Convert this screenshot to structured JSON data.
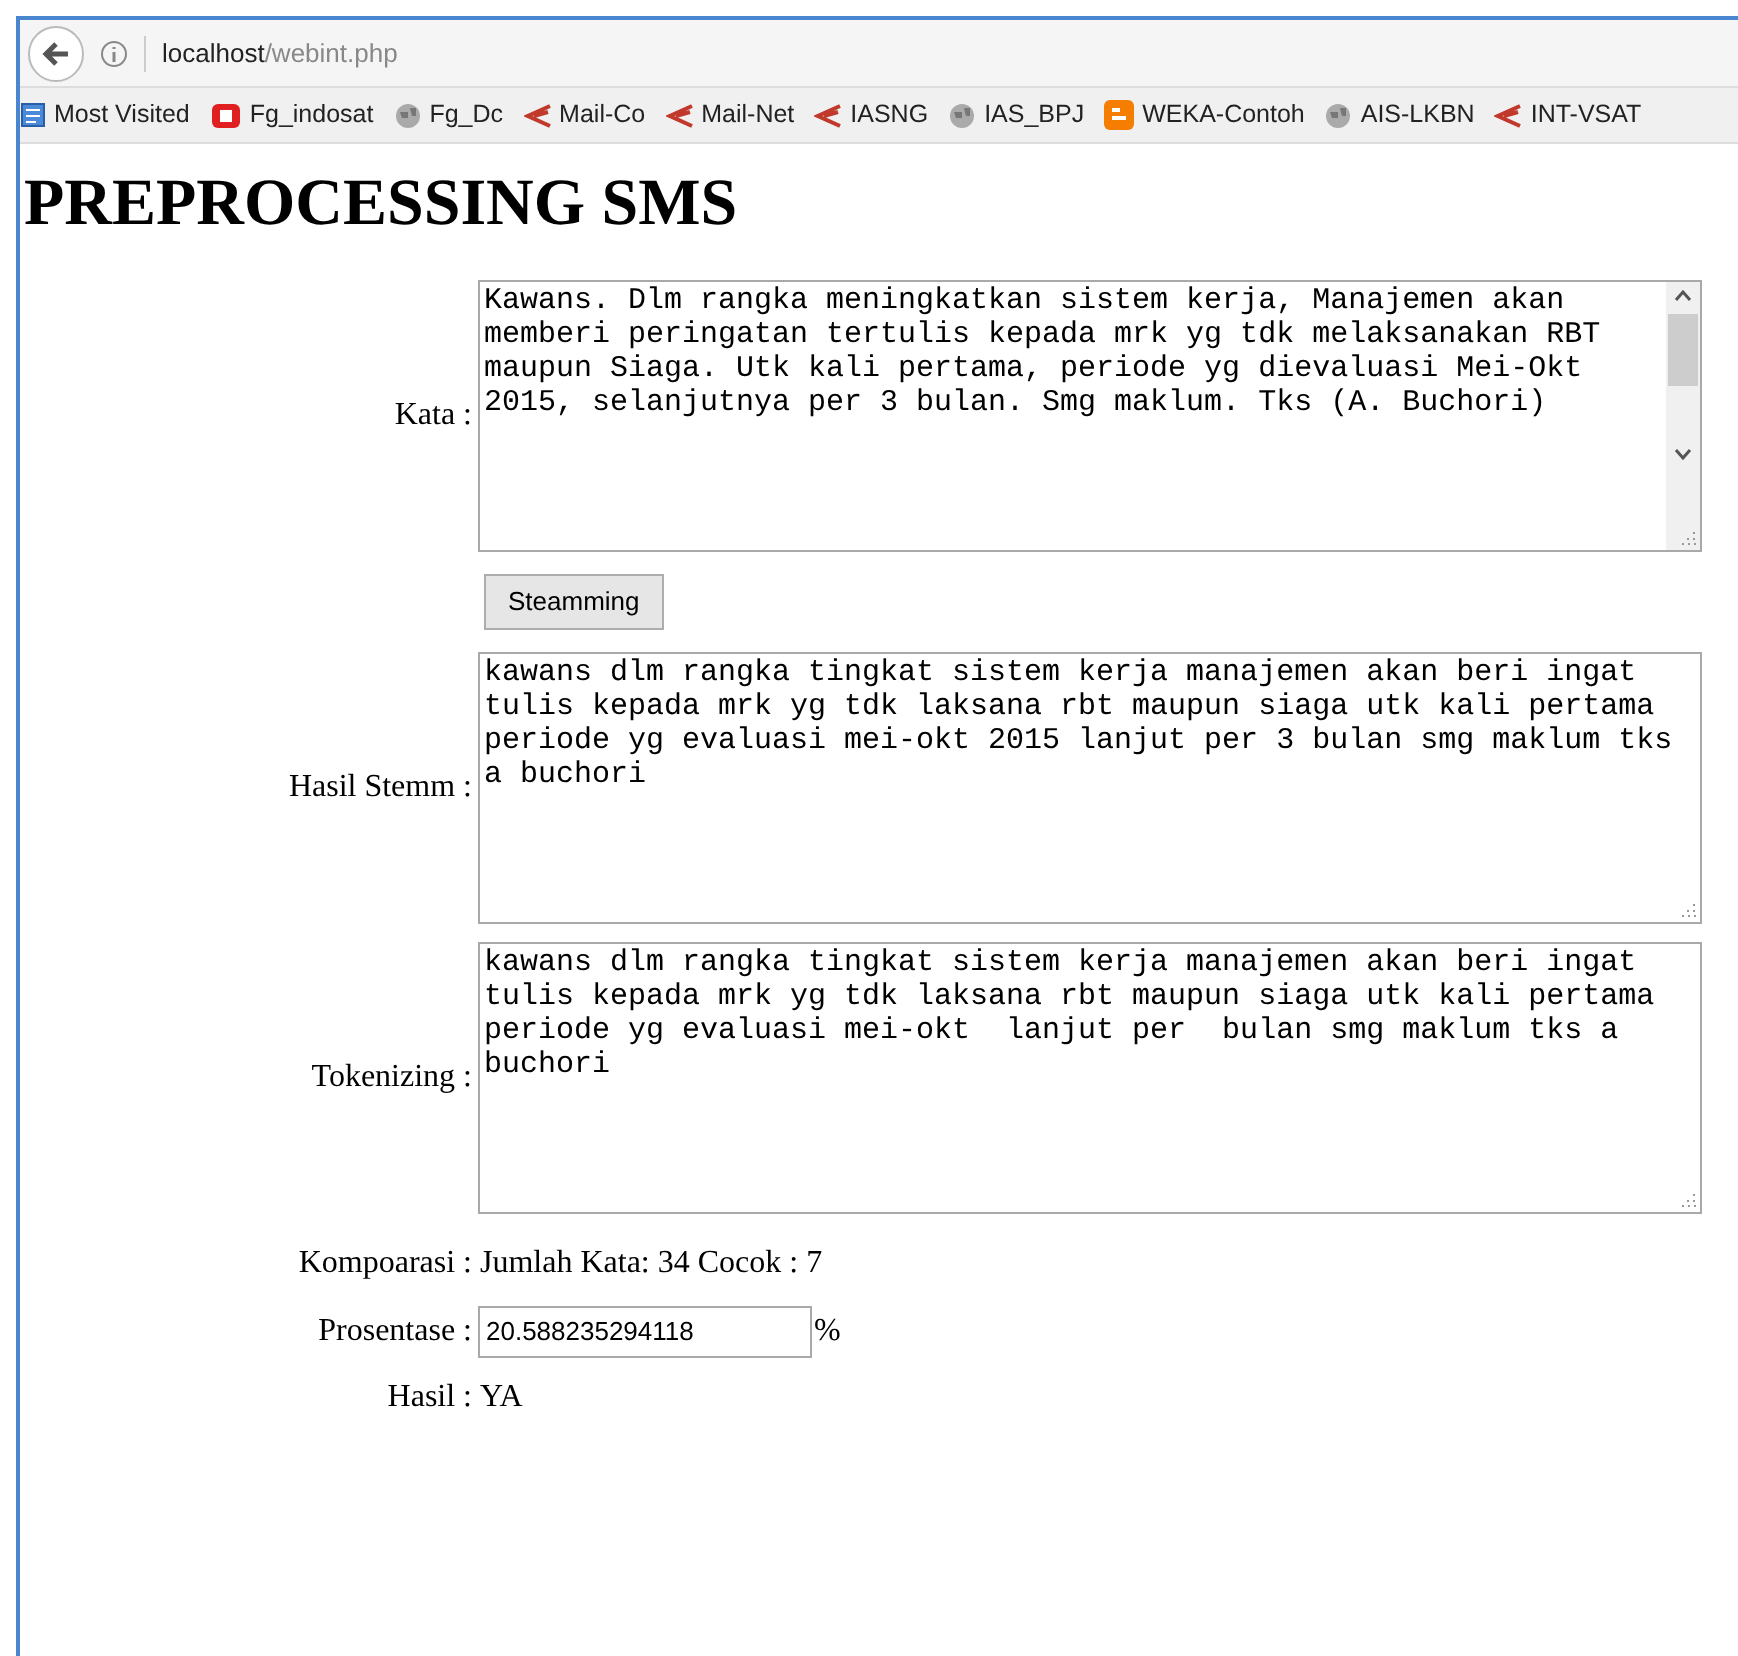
{
  "browser": {
    "url_host": "localhost",
    "url_path": "/webint.php",
    "bookmarks": [
      {
        "label": "Most Visited",
        "kind": "folder"
      },
      {
        "label": "Fg_indosat",
        "kind": "site"
      },
      {
        "label": "Fg_Dc",
        "kind": "web"
      },
      {
        "label": "Mail-Co",
        "kind": "link"
      },
      {
        "label": "Mail-Net",
        "kind": "link"
      },
      {
        "label": "IASNG",
        "kind": "link"
      },
      {
        "label": "IAS_BPJ",
        "kind": "web"
      },
      {
        "label": "WEKA-Contoh",
        "kind": "blog"
      },
      {
        "label": "AIS-LKBN",
        "kind": "web"
      },
      {
        "label": "INT-VSAT",
        "kind": "link"
      }
    ]
  },
  "page": {
    "title": "PREPROCESSING SMS",
    "kata": {
      "label": "Kata :",
      "value": "Kawans. Dlm rangka meningkatkan sistem kerja, Manajemen akan memberi peringatan tertulis kepada mrk yg tdk melaksanakan RBT maupun Siaga. Utk kali pertama, periode yg dievaluasi Mei-Okt 2015, selanjutnya per 3 bulan. Smg maklum. Tks (A. Buchori)"
    },
    "button": "Steamming",
    "hasil_stemm": {
      "label": "Hasil Stemm :",
      "value": "kawans dlm rangka tingkat sistem kerja manajemen akan beri ingat tulis kepada mrk yg tdk laksana rbt maupun siaga utk kali pertama periode yg evaluasi mei-okt 2015 lanjut per 3 bulan smg maklum tks a buchori"
    },
    "tokenizing": {
      "label": "Tokenizing :",
      "value": "kawans dlm rangka tingkat sistem kerja manajemen akan beri ingat tulis kepada mrk yg tdk laksana rbt maupun siaga utk kali pertama periode yg evaluasi mei-okt  lanjut per  bulan smg maklum tks a buchori"
    },
    "kompoarasi": {
      "label": "Kompoarasi :",
      "value": "Jumlah Kata: 34 Cocok : 7"
    },
    "prosentase": {
      "label": "Prosentase :",
      "value": "20.588235294118",
      "unit": "%"
    },
    "hasil": {
      "label": "Hasil :",
      "value": "YA"
    }
  }
}
